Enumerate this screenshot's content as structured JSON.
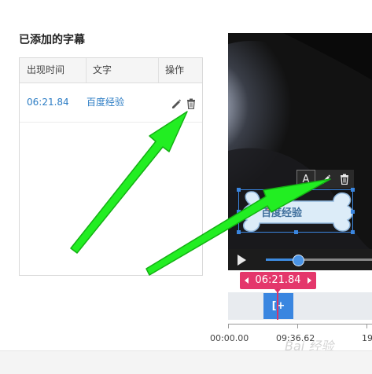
{
  "section_title": "已添加的字幕",
  "table": {
    "headers": {
      "time": "出现时间",
      "text": "文字",
      "ops": "操作"
    },
    "rows": [
      {
        "time": "06:21.84",
        "text": "百度经验",
        "edit_icon": "pencil-icon",
        "delete_icon": "trash-icon"
      }
    ]
  },
  "preview": {
    "toolbar": {
      "font_button": "A",
      "edit_icon": "pencil-icon",
      "delete_icon": "trash-icon"
    },
    "subtitle_text": "百度经验",
    "progress_fraction": 0.3,
    "play_icon": "play-icon"
  },
  "timeline": {
    "current_time": "06:21.84",
    "clip_label": "[+ +]",
    "ruler_labels": [
      "00:00.00",
      "09:36.62",
      "19"
    ]
  },
  "watermark": "Bai 经验",
  "colors": {
    "accent_blue": "#3a86e0",
    "time_chip": "#e4376b",
    "link_blue": "#2b7cc4",
    "arrow_green": "#22ee22"
  }
}
